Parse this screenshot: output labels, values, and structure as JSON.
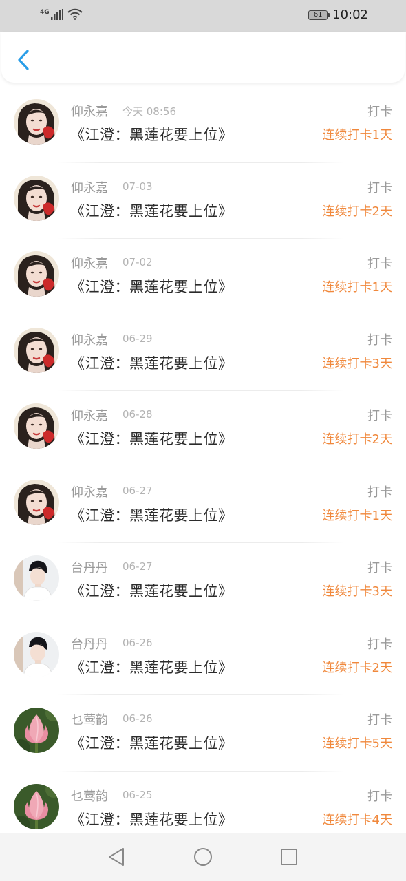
{
  "status_bar": {
    "network": "4G",
    "battery": "61",
    "time": "10:02"
  },
  "header": {
    "back_icon": "chevron-left-icon",
    "accent_color": "#2a9ee8"
  },
  "colors": {
    "streak": "#f0883c",
    "name": "#9a9a9a",
    "title": "#2b2b2b"
  },
  "records": [
    {
      "name": "仰永嘉",
      "date": "今天 08:56",
      "title": "《江澄：黑莲花要上位》",
      "action": "打卡",
      "streak": "连续打卡1天",
      "avatar": "girl-avatar"
    },
    {
      "name": "仰永嘉",
      "date": "07-03",
      "title": "《江澄：黑莲花要上位》",
      "action": "打卡",
      "streak": "连续打卡2天",
      "avatar": "girl-avatar"
    },
    {
      "name": "仰永嘉",
      "date": "07-02",
      "title": "《江澄：黑莲花要上位》",
      "action": "打卡",
      "streak": "连续打卡1天",
      "avatar": "girl-avatar"
    },
    {
      "name": "仰永嘉",
      "date": "06-29",
      "title": "《江澄：黑莲花要上位》",
      "action": "打卡",
      "streak": "连续打卡3天",
      "avatar": "girl-avatar"
    },
    {
      "name": "仰永嘉",
      "date": "06-28",
      "title": "《江澄：黑莲花要上位》",
      "action": "打卡",
      "streak": "连续打卡2天",
      "avatar": "girl-avatar"
    },
    {
      "name": "仰永嘉",
      "date": "06-27",
      "title": "《江澄：黑莲花要上位》",
      "action": "打卡",
      "streak": "连续打卡1天",
      "avatar": "girl-avatar"
    },
    {
      "name": "台丹丹",
      "date": "06-27",
      "title": "《江澄：黑莲花要上位》",
      "action": "打卡",
      "streak": "连续打卡3天",
      "avatar": "boy-avatar"
    },
    {
      "name": "台丹丹",
      "date": "06-26",
      "title": "《江澄：黑莲花要上位》",
      "action": "打卡",
      "streak": "连续打卡2天",
      "avatar": "boy-avatar"
    },
    {
      "name": "乜莺韵",
      "date": "06-26",
      "title": "《江澄：黑莲花要上位》",
      "action": "打卡",
      "streak": "连续打卡5天",
      "avatar": "lotus-avatar"
    },
    {
      "name": "乜莺韵",
      "date": "06-25",
      "title": "《江澄：黑莲花要上位》",
      "action": "打卡",
      "streak": "连续打卡4天",
      "avatar": "lotus-avatar"
    }
  ],
  "nav_bar": {
    "back": "triangle-back-icon",
    "home": "circle-home-icon",
    "recents": "square-recents-icon"
  }
}
